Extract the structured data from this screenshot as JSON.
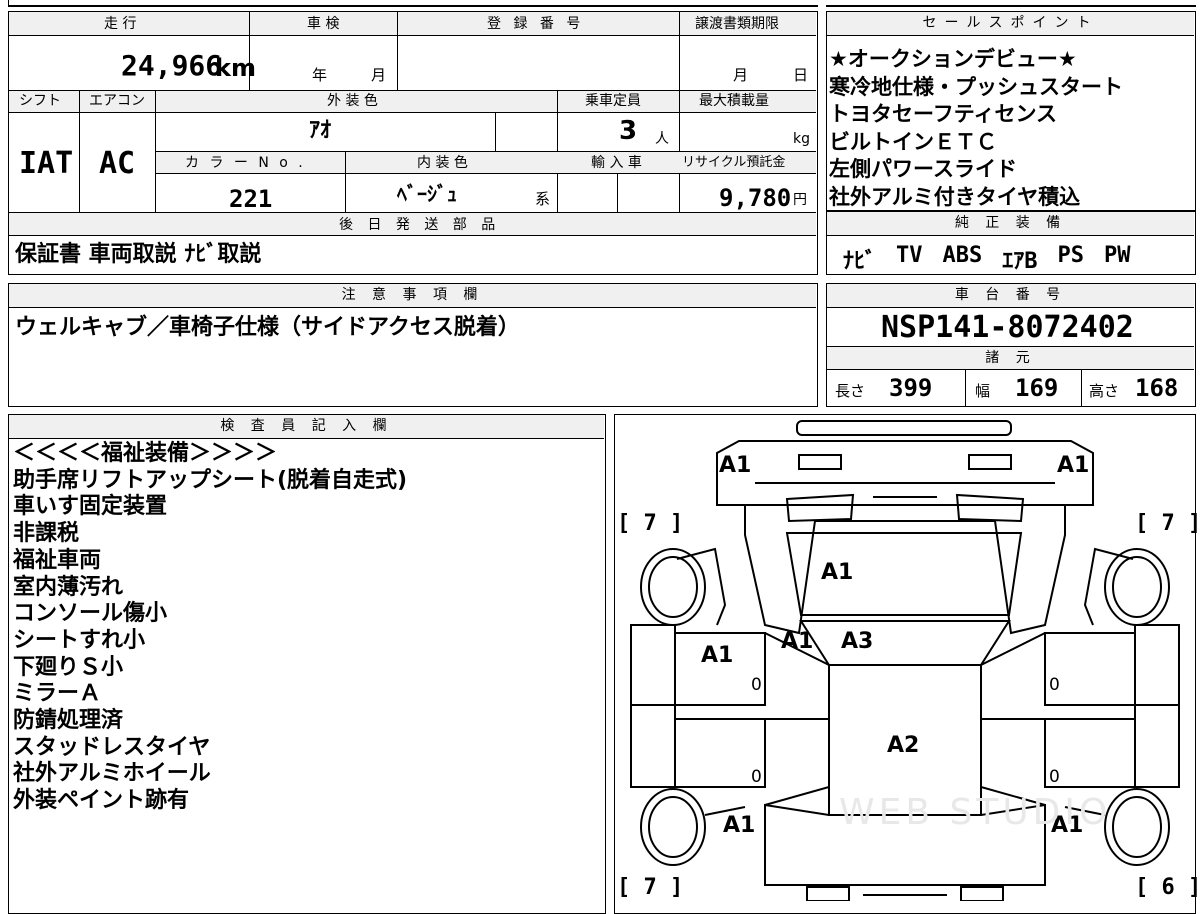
{
  "top_info": {
    "labels": {
      "mileage": "走 行",
      "inspection": "車 検",
      "registration": "登 録 番 号",
      "transfer_deadline": "譲渡書類期限",
      "shift": "シフト",
      "aircon": "エアコン",
      "exterior_color": "外 装 色",
      "capacity": "乗車定員",
      "max_load": "最大積載量",
      "color_no": "カ ラ ー N o .",
      "interior_color": "内 装 色",
      "import": "輸 入 車",
      "recycle": "リサイクル預託金",
      "later_parts": "後 日 発 送 部 品"
    },
    "mileage_value": "24,966",
    "mileage_unit": "km",
    "year_unit": "年",
    "month_unit": "月",
    "deadline_month": "月",
    "deadline_day": "日",
    "shift_value": "IAT",
    "aircon_value": "AC",
    "exterior_color_value": "ｱｵ",
    "capacity_value": "3",
    "capacity_unit": "人",
    "max_load_unit": "kg",
    "color_no_value": "221",
    "interior_color_value": "ﾍﾞｰｼﾞｭ",
    "interior_suffix": "系",
    "recycle_value": "9,780",
    "recycle_unit": "円",
    "later_parts_value": "保証書 車両取説 ﾅﾋﾞ取説"
  },
  "sales_points": {
    "header": "セールスポイント",
    "lines": [
      "★オークションデビュー★",
      "寒冷地仕様・プッシュスタート",
      "トヨタセーフティセンス",
      "ビルトインＥＴＣ",
      "左側パワースライド",
      "社外アルミ付きタイヤ積込"
    ]
  },
  "genuine_equipment": {
    "header": "純 正 装 備",
    "items": [
      "ﾅﾋﾞ",
      "TV",
      "ABS",
      "ｴｱB",
      "PS",
      "PW"
    ]
  },
  "caution": {
    "header": "注 意 事 項 欄",
    "text": "ウェルキャブ／車椅子仕様（サイドアクセス脱着）"
  },
  "chassis": {
    "header": "車 台 番 号",
    "value": "NSP141-8072402"
  },
  "specs": {
    "header": "諸 元",
    "length_label": "長さ",
    "length": "399",
    "width_label": "幅",
    "width": "169",
    "height_label": "高さ",
    "height": "168"
  },
  "inspector": {
    "header": "検 査 員 記 入 欄",
    "lines": [
      "＜＜＜＜福祉装備＞＞＞＞",
      "助手席リフトアップシート(脱着自走式)",
      "車いす固定装置",
      "非課税",
      "福祉車両",
      "室内薄汚れ",
      "コンソール傷小",
      "シートすれ小",
      "下廻りＳ小",
      "ミラーＡ",
      "防錆処理済",
      "スタッドレスタイヤ",
      "社外アルミホイール",
      "外装ペイント跡有"
    ]
  },
  "diagram": {
    "marks": {
      "front_left": "A1",
      "front_right": "A1",
      "hood": "A1",
      "windshield_left": "A1",
      "windshield": "A3",
      "left_door": "A1",
      "roof": "A2",
      "rear_left": "A1",
      "rear_right": "A1"
    },
    "tread": {
      "front_left": "[ 7 ]",
      "front_right": "[ 7 ]",
      "rear_left": "[ 7 ]",
      "rear_right": "[ 6 ]"
    },
    "door_zeros": [
      "0",
      "0",
      "0",
      "0"
    ],
    "watermark": "WEB STUDIO"
  }
}
